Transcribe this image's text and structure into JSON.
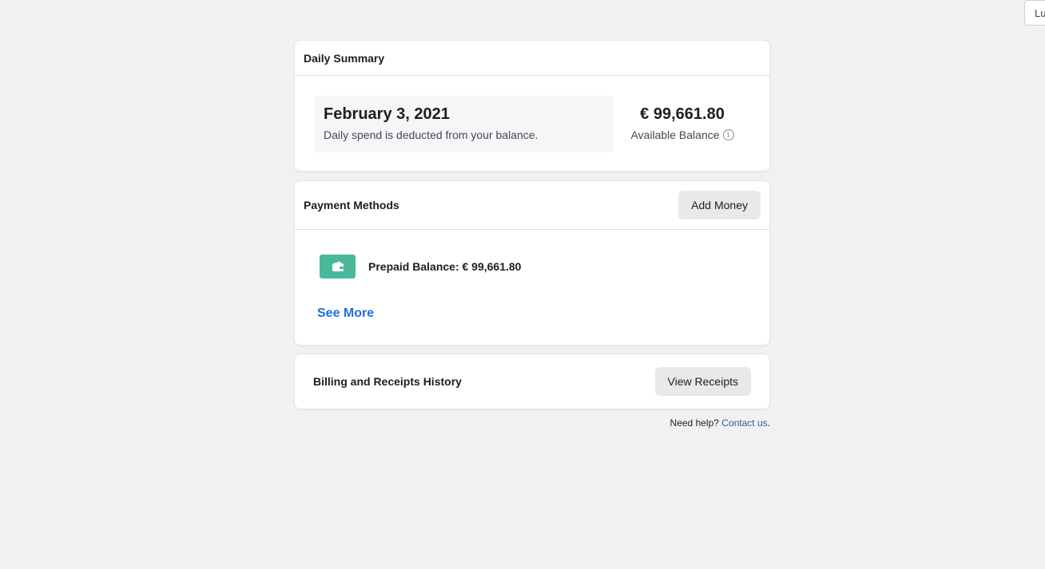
{
  "corner_widget": {
    "text": "Lu"
  },
  "daily_summary": {
    "title": "Daily Summary",
    "date": "February 3, 2021",
    "note": "Daily spend is deducted from your balance.",
    "balance_amount": "€ 99,661.80",
    "balance_label": "Available Balance",
    "info_icon": "info-icon"
  },
  "payment_methods": {
    "title": "Payment Methods",
    "add_money_label": "Add Money",
    "method_icon": "wallet-icon",
    "method_icon_color": "#4bb89c",
    "method_label": "Prepaid Balance: € 99,661.80",
    "see_more_label": "See More"
  },
  "billing": {
    "title": "Billing and Receipts History",
    "view_receipts_label": "View Receipts"
  },
  "help": {
    "prefix": "Need help?",
    "link_label": "Contact us",
    "suffix": "."
  },
  "colors": {
    "page_background": "#f1f1f1",
    "link": "#216fdb",
    "button_background": "#e9e9e9"
  }
}
